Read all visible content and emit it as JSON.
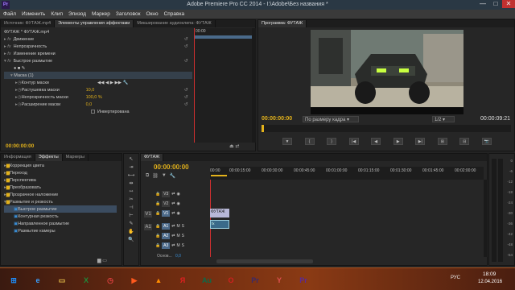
{
  "window": {
    "title": "Adobe Premiere Pro CC 2014 - I:\\Adobe\\Без названия *",
    "app_icon": "Pr",
    "minimize": "—",
    "maximize": "□",
    "close": "✕"
  },
  "menu": [
    "Файл",
    "Изменить",
    "Клип",
    "Эпизод",
    "Маркер",
    "Заголовок",
    "Окно",
    "Справка"
  ],
  "source_tabs": [
    "Источник: ФУТАЖ.mp4",
    "Элементы управления эффектами",
    "Микширование аудиоклипа: ФУТАЖ"
  ],
  "effects": {
    "header": "ФУТАЖ * ФУТАЖ.mp4",
    "ruler_time": "00:00",
    "rows": [
      {
        "label": "Движение"
      },
      {
        "label": "Непрозрачность"
      },
      {
        "label": "Изменение времени"
      },
      {
        "label": "Быстрое размытие"
      }
    ],
    "mask": "Маска (1)",
    "mask_path": "Контур маски",
    "params": [
      {
        "label": "Растушевка маски",
        "value": "10,0"
      },
      {
        "label": "Непрозрачность маски",
        "value": "100,0 %"
      },
      {
        "label": "Расширение маски",
        "value": "0,0"
      }
    ],
    "invert": "Инвертирована",
    "timecode": "00:00:00:00"
  },
  "program": {
    "tab": "Программа: ФУТАЖ",
    "timecode_left": "00:00:00:00",
    "fit": "По размеру кадра",
    "resolution": "1/2",
    "timecode_right": "00:00:09:21"
  },
  "transport": [
    "▼",
    "{",
    "}",
    "|◀",
    "◀",
    "▶",
    "▶|",
    "⊞",
    "⊟",
    "📷"
  ],
  "project": {
    "tabs": [
      "Информация",
      "Эффекты",
      "Маркеры"
    ],
    "items": [
      {
        "label": "Коррекция цвета",
        "folder": true
      },
      {
        "label": "Переход",
        "folder": true
      },
      {
        "label": "Перспектива",
        "folder": true
      },
      {
        "label": "Преобразовать",
        "folder": true
      },
      {
        "label": "Прозрачное наложение",
        "folder": true
      },
      {
        "label": "Размытие и резкость",
        "folder": true
      },
      {
        "label": "Быстрое размытие",
        "folder": false,
        "selected": true
      },
      {
        "label": "Контурная резкость",
        "folder": false
      },
      {
        "label": "Направленное размытие",
        "folder": false
      },
      {
        "label": "Размытие камеры",
        "folder": false
      }
    ]
  },
  "timeline": {
    "tab": "ФУТАЖ",
    "timecode": "00:00:00:00",
    "ruler": [
      "00:00",
      "00:00:15:00",
      "00:00:30:00",
      "00:00:45:00",
      "00:01:00:00",
      "00:01:15:00",
      "00:01:30:00",
      "00:01:45:00",
      "00:02:00:00"
    ],
    "video_tracks": [
      {
        "name": "V3"
      },
      {
        "name": "V2"
      },
      {
        "name": "V1"
      }
    ],
    "audio_tracks": [
      {
        "name": "A1",
        "m": "M",
        "s": "S"
      },
      {
        "name": "A2",
        "m": "M",
        "s": "S"
      },
      {
        "name": "A3",
        "m": "M",
        "s": "S"
      }
    ],
    "src_v": "V1",
    "src_a": "A1",
    "clip_video": "ФУТАЖ",
    "clip_audio": "fx",
    "master": "Основ...",
    "master_val": "0,0"
  },
  "meter_labels": [
    "0",
    "-6",
    "-12",
    "-18",
    "-24",
    "-30",
    "-36",
    "-42",
    "-48",
    "-54"
  ],
  "taskbar": {
    "time": "18:09",
    "date": "12.04.2016",
    "lang": "РУС",
    "icons": [
      {
        "name": "start",
        "glyph": "⊞",
        "color": "#1e90ff"
      },
      {
        "name": "ie",
        "glyph": "e",
        "color": "#3aa0ff"
      },
      {
        "name": "explorer",
        "glyph": "▭",
        "color": "#e8c04a"
      },
      {
        "name": "excel",
        "glyph": "X",
        "color": "#1f8a3a"
      },
      {
        "name": "clock",
        "glyph": "◷",
        "color": "#e04040"
      },
      {
        "name": "media",
        "glyph": "▶",
        "color": "#ff5a1e"
      },
      {
        "name": "vlc",
        "glyph": "▲",
        "color": "#ff8c00"
      },
      {
        "name": "yandex",
        "glyph": "Я",
        "color": "#e02020"
      },
      {
        "name": "audition",
        "glyph": "Au",
        "color": "#0a6b4a"
      },
      {
        "name": "opera",
        "glyph": "O",
        "color": "#d02020"
      },
      {
        "name": "premiere-old",
        "glyph": "Pr",
        "color": "#3a2a6a"
      },
      {
        "name": "yandex2",
        "glyph": "Y",
        "color": "#e05050"
      },
      {
        "name": "premiere",
        "glyph": "Pr",
        "color": "#5a2a9a"
      }
    ]
  }
}
